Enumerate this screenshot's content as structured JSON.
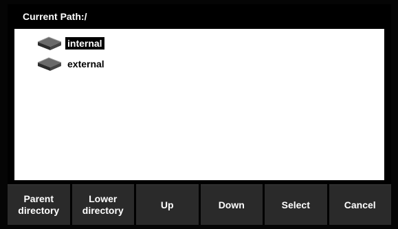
{
  "header": {
    "path_label": "Current",
    "path_key": "Path:",
    "path_value": "/"
  },
  "file_tree": {
    "items": [
      {
        "label": "internal",
        "icon": "drive-icon",
        "selected": true
      },
      {
        "label": "external",
        "icon": "drive-icon",
        "selected": false
      }
    ]
  },
  "softkeys": [
    {
      "label": "Parent\ndirectory"
    },
    {
      "label": "Lower\ndirectory"
    },
    {
      "label": "Up"
    },
    {
      "label": "Down"
    },
    {
      "label": "Select"
    },
    {
      "label": "Cancel"
    }
  ]
}
